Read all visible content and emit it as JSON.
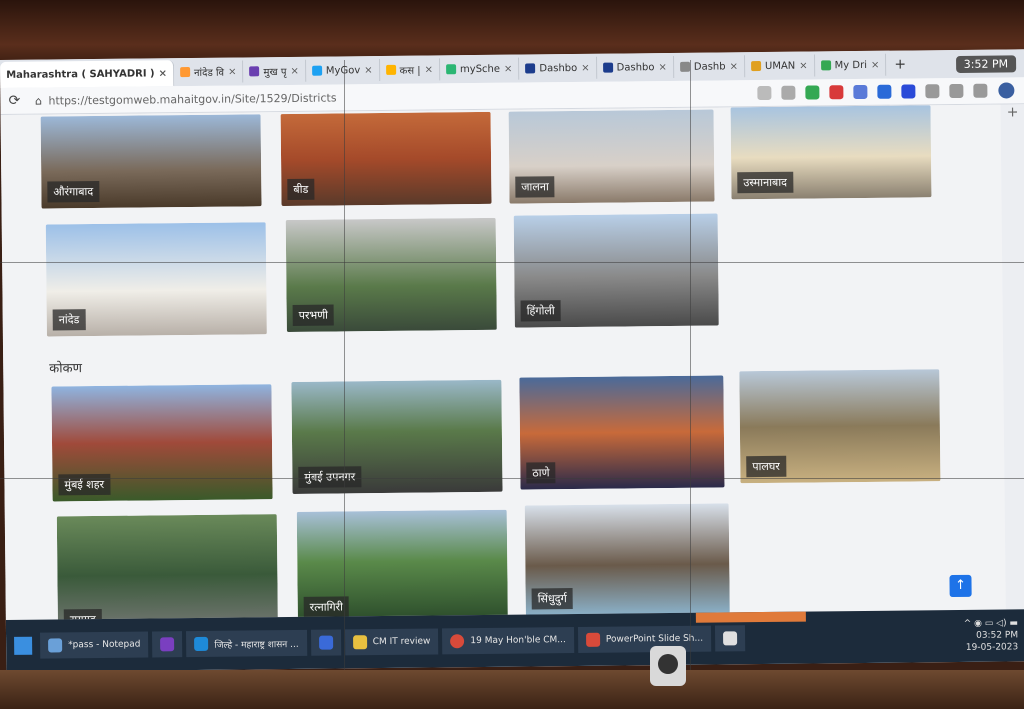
{
  "browser": {
    "tabs": [
      {
        "label": "Maharashtra ( SAHYADRI )",
        "active": true,
        "color": "#1e73e8"
      },
      {
        "label": "नांदेड वि",
        "color": "#ff9933"
      },
      {
        "label": "मुख पृ",
        "color": "#6a3fb0"
      },
      {
        "label": "MyGov",
        "color": "#1da1f2"
      },
      {
        "label": "कस |",
        "color": "#ffb400"
      },
      {
        "label": "mySche",
        "color": "#2bb673"
      },
      {
        "label": "Dashbo",
        "color": "#1c3c8c"
      },
      {
        "label": "Dashbo",
        "color": "#1c3c8c"
      },
      {
        "label": "Dashb",
        "color": "#888888"
      },
      {
        "label": "UMAN",
        "color": "#e0a020"
      },
      {
        "label": "My Dri",
        "color": "#34a853"
      }
    ],
    "close_glyph": "×",
    "newtab_glyph": "+",
    "clock": "3:52 PM",
    "url": "https://testgomweb.mahaitgov.in/Site/1529/Districts",
    "reload_icon": "⟳",
    "lock_icon": "⌂"
  },
  "districts": {
    "row1": [
      {
        "label": "औरंगाबाद",
        "bg": "linear-gradient(#9cb8d8,#7a6a5a 60%,#4a3a2a)"
      },
      {
        "label": "बीड",
        "bg": "linear-gradient(#c46a3a,#a54a2a 50%,#5a3a2a)"
      },
      {
        "label": "जालना",
        "bg": "linear-gradient(#b8c8d8,#d8d0c8 60%,#8a7a6a)"
      },
      {
        "label": "उस्मानाबाद",
        "bg": "linear-gradient(#a8c4e0,#e8dcc0 55%,#8a8070)"
      }
    ],
    "row2": [
      {
        "label": "नांदेड",
        "bg": "linear-gradient(#9cc0e8,#f0eee8 60%,#b8b0a8)"
      },
      {
        "label": "परभणी",
        "bg": "linear-gradient(#c8c8c8,#5a7a4a 60%,#3a4a3a)"
      },
      {
        "label": "हिंगोली",
        "bg": "linear-gradient(#b8cfe8,#8a8a8a 55%,#4a4a4a)"
      }
    ],
    "section_title": "कोकण",
    "row3": [
      {
        "label": "मुंबई शहर",
        "bg": "linear-gradient(#8fb4e0,#a04a3a 50%,#3a5a2a)"
      },
      {
        "label": "मुंबई उपनगर",
        "bg": "linear-gradient(#9ab8c8,#5a7a4a 45%,#3a3a3a)"
      },
      {
        "label": "ठाणे",
        "bg": "linear-gradient(#4a6a9a,#c86a3a 50%,#2a2a4a)"
      },
      {
        "label": "पालघर",
        "bg": "linear-gradient(#b8c8d8,#8a7a5a 50%,#c8b080)"
      }
    ],
    "row4": [
      {
        "label": "रायगड",
        "bg": "linear-gradient(#6a8a5a,#3a5a3a 50%,#7a7a7a)"
      },
      {
        "label": "रत्नागिरी",
        "bg": "linear-gradient(#a8c0d8,#5a8a4a 45%,#2a4a2a)"
      },
      {
        "label": "सिंधुदुर्ग",
        "bg": "linear-gradient(#d8e0ea,#6a5a4a 55%,#8ab0c8)"
      }
    ],
    "scroll_top": "↑",
    "side_plus": "+"
  },
  "taskbar": {
    "items": [
      {
        "label": "*pass - Notepad",
        "color": "#6aa0d8"
      },
      {
        "label": "",
        "color": "#7a3fc0"
      },
      {
        "label": "जिल्हे - महाराष्ट्र शासन ...",
        "color": "#1e8ad8"
      },
      {
        "label": "",
        "color": "#3a6ad8"
      },
      {
        "label": "CM IT review",
        "color": "#e8c040"
      },
      {
        "label": "19 May Hon'ble CM...",
        "color": "#d84a3a"
      },
      {
        "label": "PowerPoint Slide Sh...",
        "color": "#d84a3a"
      },
      {
        "label": "",
        "color": "#e0e0e0"
      }
    ],
    "time": "03:52 PM",
    "date": "19-05-2023",
    "tray": "^ ◉ ▭ ◁) ▬"
  }
}
